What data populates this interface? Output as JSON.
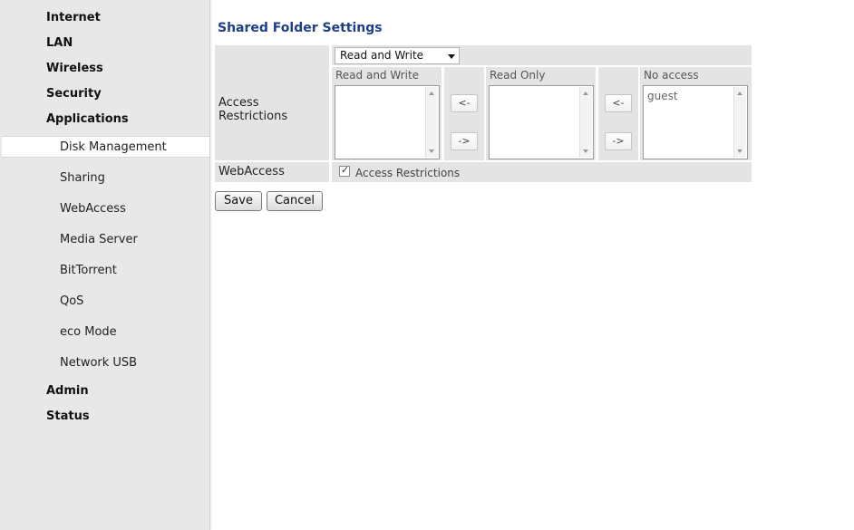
{
  "page_title": "Shared Folder Settings",
  "sidebar": {
    "top_items": [
      {
        "label": "Internet"
      },
      {
        "label": "LAN"
      },
      {
        "label": "Wireless"
      },
      {
        "label": "Security"
      },
      {
        "label": "Applications"
      }
    ],
    "sub_items": [
      {
        "label": "Disk Management",
        "active": true
      },
      {
        "label": "Sharing"
      },
      {
        "label": "WebAccess"
      },
      {
        "label": "Media Server"
      },
      {
        "label": "BitTorrent"
      },
      {
        "label": "QoS"
      },
      {
        "label": "eco Mode"
      },
      {
        "label": "Network USB"
      }
    ],
    "bottom_items": [
      {
        "label": "Admin"
      },
      {
        "label": "Status"
      }
    ]
  },
  "access_restrictions": {
    "label": "Access Restrictions",
    "select_value": "Read and Write",
    "columns": {
      "read_write": {
        "header": "Read and Write",
        "items": []
      },
      "read_only": {
        "header": "Read Only",
        "items": []
      },
      "no_access": {
        "header": "No access",
        "items": [
          "guest"
        ]
      }
    },
    "move_left": "<-",
    "move_right": "->"
  },
  "webaccess": {
    "label": "WebAccess",
    "checkbox_label": "Access Restrictions",
    "checked": true,
    "check_mark": "✓"
  },
  "buttons": {
    "save": "Save",
    "cancel": "Cancel"
  }
}
